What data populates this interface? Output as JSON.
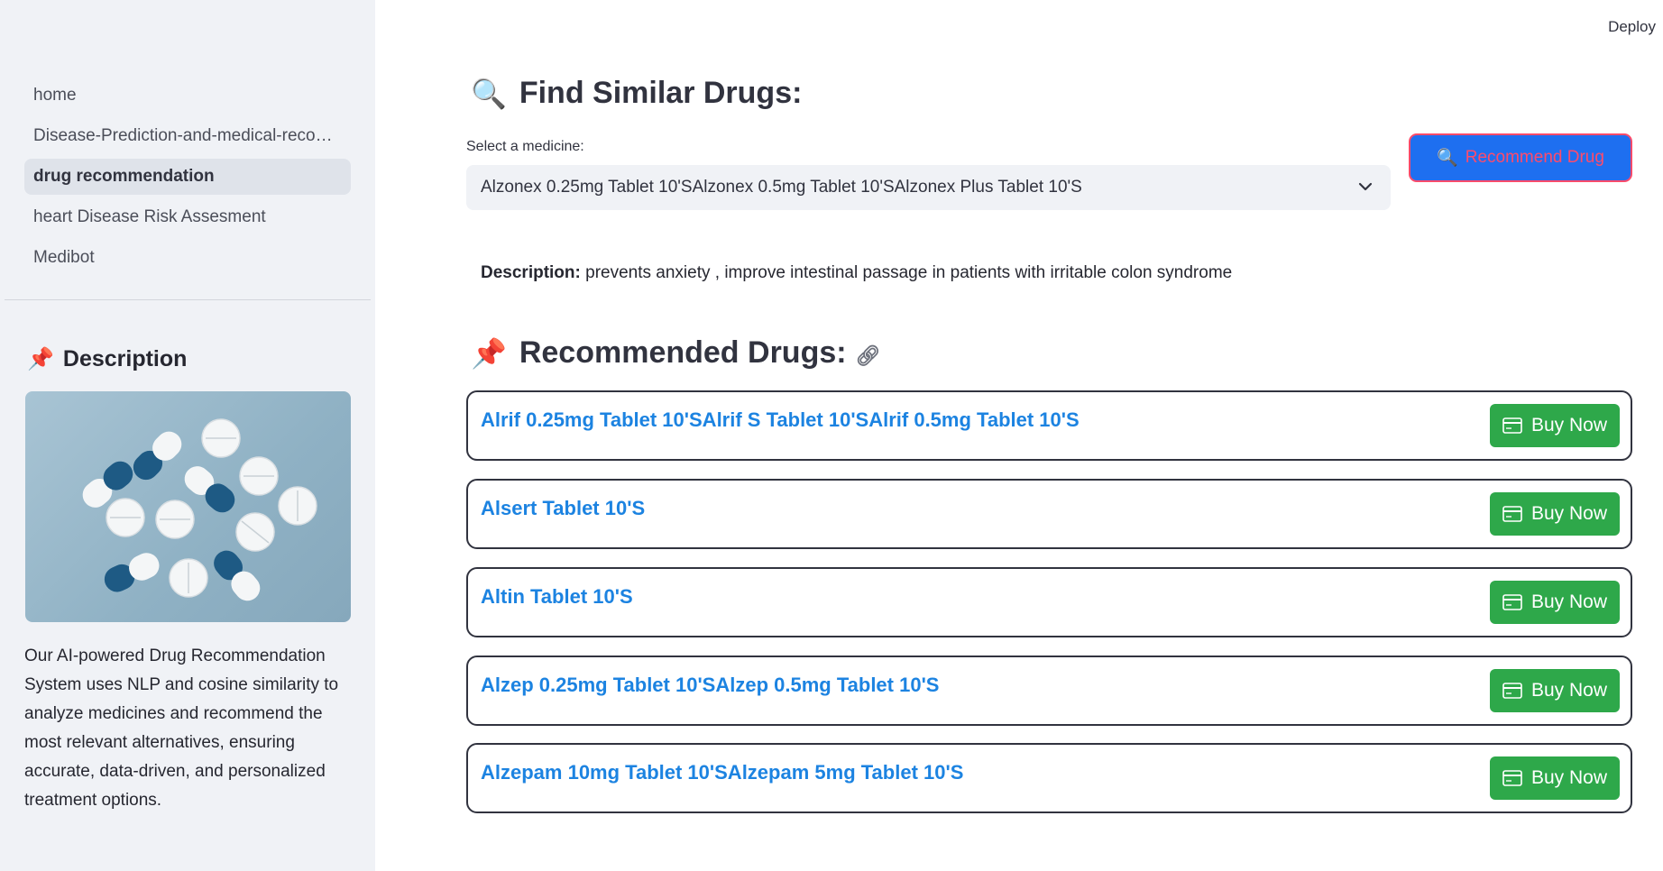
{
  "header": {
    "deploy_label": "Deploy"
  },
  "sidebar": {
    "nav_items": [
      {
        "label": "home",
        "active": false
      },
      {
        "label": "Disease-Prediction-and-medical-reco…",
        "active": false
      },
      {
        "label": "drug recommendation",
        "active": true
      },
      {
        "label": "heart Disease Risk Assesment",
        "active": false
      },
      {
        "label": "Medibot",
        "active": false
      }
    ],
    "section_title": "Description",
    "section_icon": "pushpin-icon",
    "image_alt": "pills-image",
    "description": "Our AI-powered Drug Recommendation System uses NLP and cosine similarity to analyze medicines and recommend the most relevant alternatives, ensuring accurate, data-driven, and personalized treatment options."
  },
  "main": {
    "title": "Find Similar Drugs:",
    "title_icon": "magnifier-icon",
    "select_label": "Select a medicine:",
    "selected_medicine": "Alzonex 0.25mg Tablet 10'SAlzonex 0.5mg Tablet 10'SAlzonex Plus Tablet 10'S",
    "recommend_button": "Recommend Drug",
    "description_label": "Description:",
    "description_text": " prevents anxiety , improve intestinal passage in patients with irritable colon syndrome",
    "recommended_title": "Recommended Drugs:",
    "recommended_icon": "pushpin-icon",
    "buy_label": "Buy Now",
    "drugs": [
      "Alrif 0.25mg Tablet 10'SAlrif S Tablet 10'SAlrif 0.5mg Tablet 10'S",
      "Alsert Tablet 10'S",
      "Altin Tablet 10'S",
      "Alzep 0.25mg Tablet 10'SAlzep 0.5mg Tablet 10'S",
      "Alzepam 10mg Tablet 10'SAlzepam 5mg Tablet 10'S"
    ]
  },
  "colors": {
    "sidebar_bg": "#f0f2f6",
    "link_blue": "#1c83e1",
    "buy_green": "#2ea84a",
    "recommend_bg": "#1e6ff0",
    "recommend_text": "#ff4b6b"
  }
}
